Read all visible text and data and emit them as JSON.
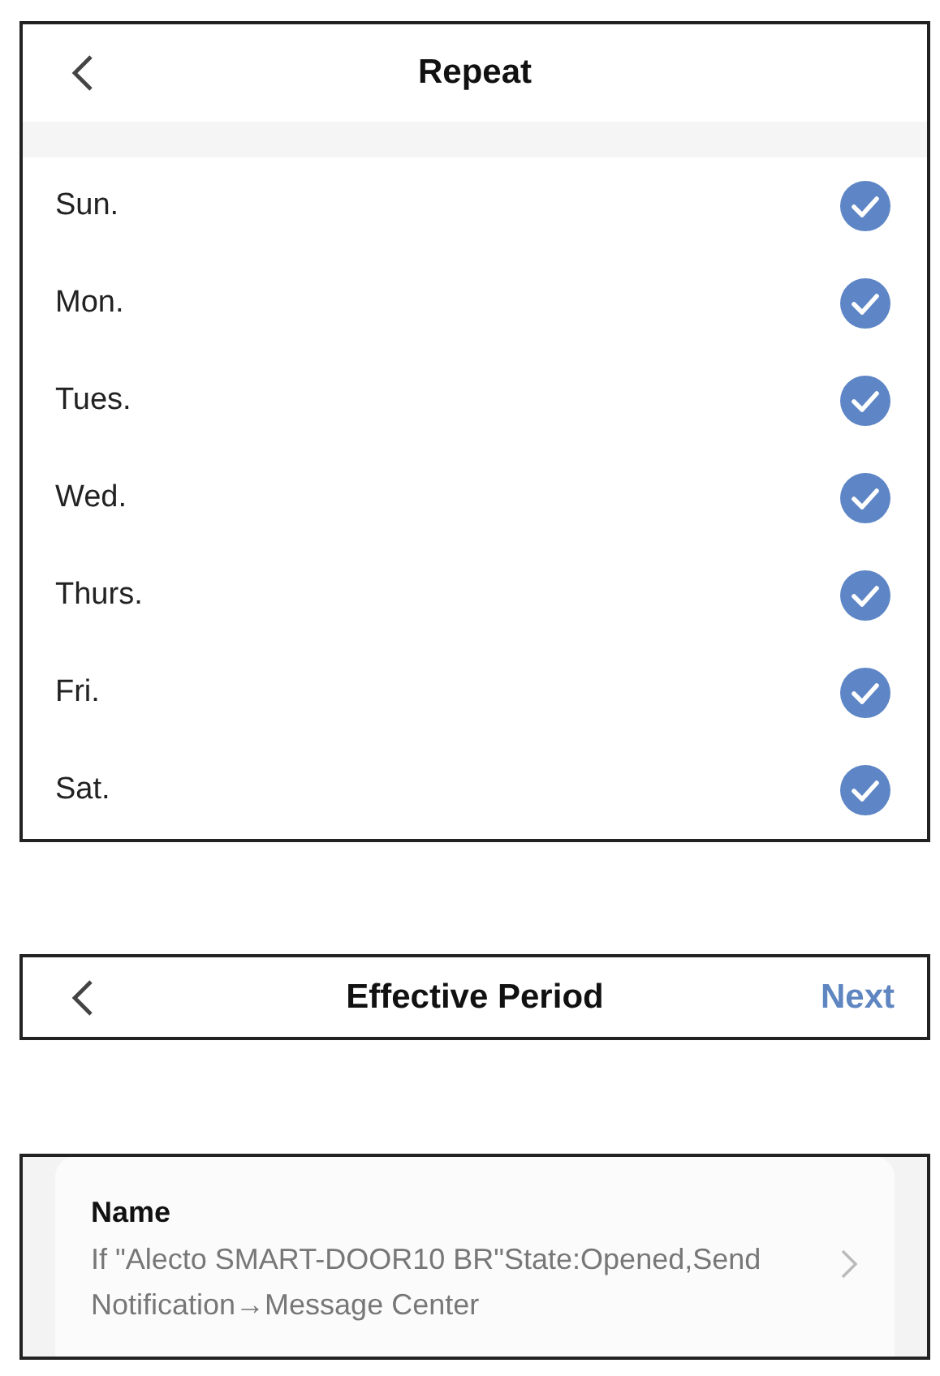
{
  "repeat_screen": {
    "title": "Repeat",
    "days": [
      {
        "label": "Sun.",
        "checked": true
      },
      {
        "label": "Mon.",
        "checked": true
      },
      {
        "label": "Tues.",
        "checked": true
      },
      {
        "label": "Wed.",
        "checked": true
      },
      {
        "label": "Thurs.",
        "checked": true
      },
      {
        "label": "Fri.",
        "checked": true
      },
      {
        "label": "Sat.",
        "checked": true
      }
    ]
  },
  "period_screen": {
    "title": "Effective Period",
    "action": "Next"
  },
  "name_screen": {
    "label": "Name",
    "value": "If \"Alecto SMART-DOOR10 BR\"State:Opened,Send Notification→Message Center"
  }
}
